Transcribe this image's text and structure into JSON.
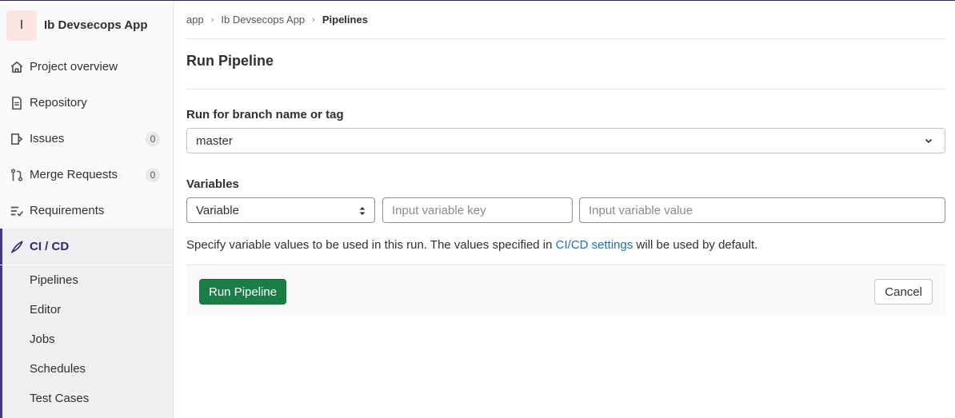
{
  "project": {
    "avatar_letter": "I",
    "name": "Ib Devsecops App"
  },
  "sidebar": {
    "items": [
      {
        "label": "Project overview",
        "icon": "home-icon"
      },
      {
        "label": "Repository",
        "icon": "document-icon"
      },
      {
        "label": "Issues",
        "icon": "issues-icon",
        "count": "0"
      },
      {
        "label": "Merge Requests",
        "icon": "merge-request-icon",
        "count": "0"
      },
      {
        "label": "Requirements",
        "icon": "requirements-icon"
      },
      {
        "label": "CI / CD",
        "icon": "rocket-icon",
        "active": true
      }
    ],
    "subitems": [
      "Pipelines",
      "Editor",
      "Jobs",
      "Schedules",
      "Test Cases"
    ]
  },
  "breadcrumb": {
    "items": [
      "app",
      "Ib Devsecops App"
    ],
    "current": "Pipelines",
    "separator": "›"
  },
  "page": {
    "title": "Run Pipeline"
  },
  "form": {
    "branch_label": "Run for branch name or tag",
    "branch_value": "master",
    "variables_label": "Variables",
    "variable_type": "Variable",
    "key_placeholder": "Input variable key",
    "value_placeholder": "Input variable value",
    "help_prefix": "Specify variable values to be used in this run. The values specified in ",
    "help_link": "CI/CD settings",
    "help_suffix": " will be used by default."
  },
  "actions": {
    "run_label": "Run Pipeline",
    "cancel_label": "Cancel"
  },
  "colors": {
    "run_button": "#1a7f47",
    "link": "#1f6fbf",
    "active_nav": "#2c2a6b"
  }
}
